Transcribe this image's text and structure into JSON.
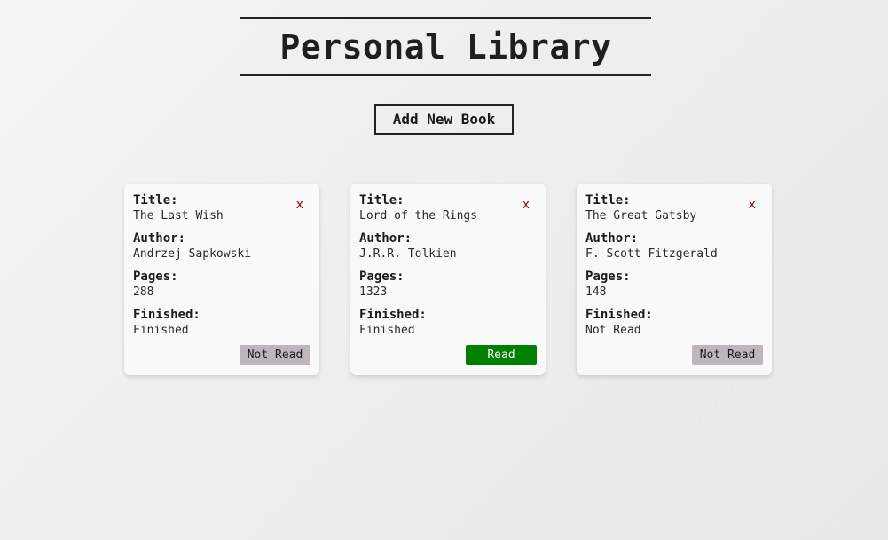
{
  "header": {
    "title": "Personal Library"
  },
  "toolbar": {
    "add_label": "Add New Book"
  },
  "labels": {
    "title": "Title:",
    "author": "Author:",
    "pages": "Pages:",
    "finished": "Finished:",
    "remove": "x"
  },
  "books": [
    {
      "title": "The Last Wish",
      "author": "Andrzej Sapkowski",
      "pages": "288",
      "finished": "Finished",
      "status_button": "Not Read",
      "status_color": "#bdb7bd"
    },
    {
      "title": "Lord of the Rings",
      "author": "J.R.R. Tolkien",
      "pages": "1323",
      "finished": "Finished",
      "status_button": "Read",
      "status_color": "#008000"
    },
    {
      "title": "The Great Gatsby",
      "author": "F. Scott Fitzgerald",
      "pages": "148",
      "finished": "Not Read",
      "status_button": "Not Read",
      "status_color": "#bdb7bd"
    }
  ]
}
